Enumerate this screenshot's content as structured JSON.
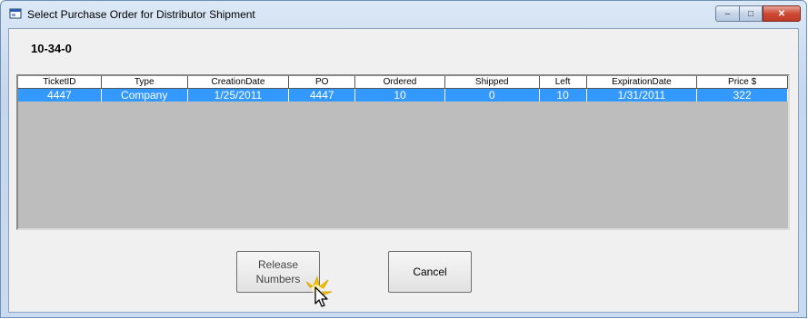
{
  "window": {
    "title": "Select Purchase Order for Distributor Shipment",
    "caption_minimize": "–",
    "caption_maximize": "□",
    "caption_close": "✕"
  },
  "item_code": "10-34-0",
  "grid": {
    "columns": [
      "TicketID",
      "Type",
      "CreationDate",
      "PO",
      "Ordered",
      "Shipped",
      "Left",
      "ExpirationDate",
      "Price $"
    ],
    "rows": [
      [
        "4447",
        "Company",
        "1/25/2011",
        "4447",
        "10",
        "0",
        "10",
        "1/31/2011",
        "322"
      ]
    ],
    "selected_row_color": "#3399ff",
    "empty_area_color": "#bdbdbd"
  },
  "buttons": {
    "release_line1": "Release",
    "release_line2": "Numbers",
    "cancel": "Cancel"
  },
  "icons": {
    "window_icon": "app-window-icon",
    "cursor": "hand-pointer-cursor-icon"
  }
}
